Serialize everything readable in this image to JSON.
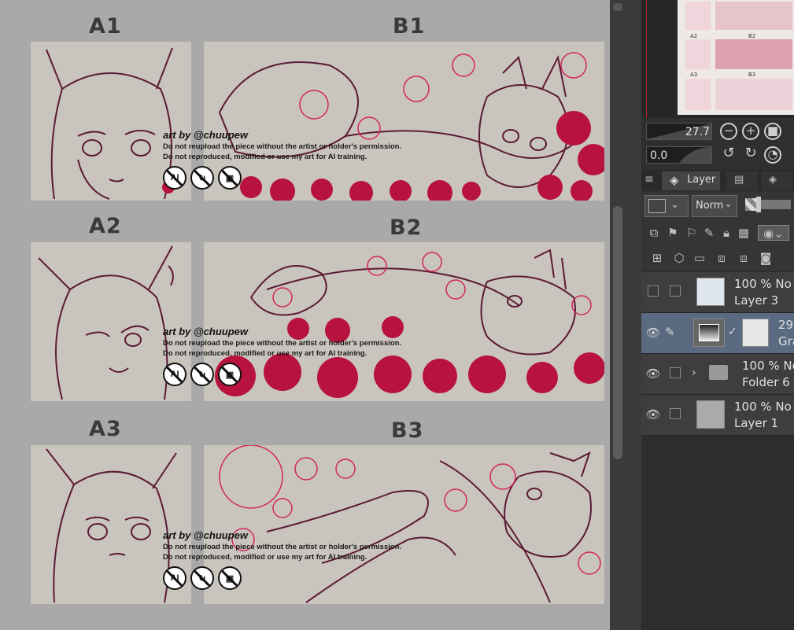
{
  "canvas": {
    "row_labels": [
      "A1",
      "B1",
      "A2",
      "B2",
      "A3",
      "B3"
    ],
    "watermark": {
      "credit": "art by @chuupew",
      "line1": "Do not reupload the piece without the artist or holder's permission.",
      "line2": "Do not reproduced, modified or use my art for AI training.",
      "icon_ai": "AI",
      "icons": [
        "no-ai-icon",
        "no-repost-icon",
        "no-edit-icon"
      ]
    },
    "colors": {
      "background": "#a9a9a9",
      "panel": "#c9c4bd",
      "lineart": "#5c1a36",
      "flowers": "#b8123f"
    }
  },
  "navigator": {
    "labels": [
      "A2",
      "B2",
      "A3",
      "B3"
    ]
  },
  "controls": {
    "zoom_value": "27.7",
    "rotate_value": "0.0"
  },
  "tabs": {
    "layer_label": "Layer"
  },
  "layer_toolbar": {
    "blend_mode": "Norm"
  },
  "layers": [
    {
      "pct": "100 % No",
      "name": "Layer 3",
      "visible": false
    },
    {
      "pct": "29",
      "name": "Gra",
      "visible": true,
      "active": true
    },
    {
      "pct": "100 % No",
      "name": "Folder 6",
      "visible": true,
      "folder": true
    },
    {
      "pct": "100 % No",
      "name": "Layer 1",
      "visible": true
    }
  ]
}
